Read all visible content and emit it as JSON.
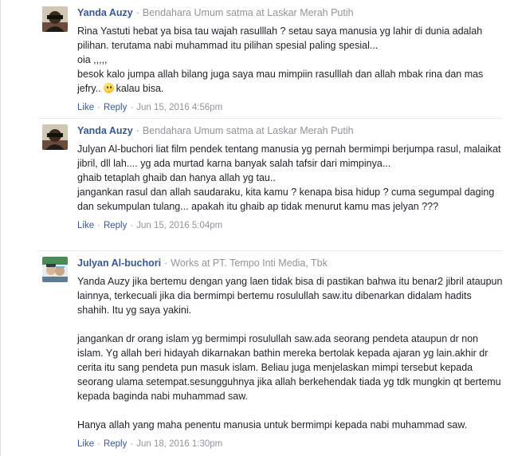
{
  "comments": [
    {
      "author": "Yanda Auzy",
      "role": "Bendahara Umum satma at Laskar Merah Putih",
      "lines": [
        "Rina Yastuti hebat ya bisa tau wajah rasulllah ? setau saya manusia yg lahir di dunia adalah pilihan. terutama nabi muhammad itu pilihan spesial paling spesial...",
        "oia ,,,,,",
        "besok kalo jumpa allah bilang juga saya mau mimpiin rasulllah dan allah mbak rina dan mas jefry..",
        "kalau bisa."
      ],
      "like": "Like",
      "reply": "Reply",
      "time": "Jun 15, 2016 4:56pm"
    },
    {
      "author": "Yanda Auzy",
      "role": "Bendahara Umum satma at Laskar Merah Putih",
      "lines": [
        "Julyan Al-buchori liat film pendek tentang manusia yg pernah bermimpi berjumpa rasul, malaikat jibril, dll lah.... yg ada murtad karna banyak salah tafsir dari mimpinya...",
        "ghaib tetaplah ghaib dan hanya allah yg tau..",
        "jangankan rasul dan allah saudaraku, kita kamu ? kenapa bisa hidup ? cuma segumpal daging dan sekumpulan tulang... apakah itu ghaib ap tidak menurut kamu mas jelyan ???"
      ],
      "like": "Like",
      "reply": "Reply",
      "time": "Jun 15, 2016 5:04pm"
    },
    {
      "author": "Julyan Al-buchori",
      "role": "Works at PT. Tempo Inti Media, Tbk",
      "lines": [
        "Yanda Auzy jika bertemu dengan yang laen tidak bisa di pastikan bahwa itu benar2 jibril ataupun lainnya, terkecuali jika dia bermimpi bertemu rosulullah saw.itu dibenarkan didalam hadits shahih. Itu yg saya yakini.",
        "jangankan dr orang islam yg bermimpi rosulullah saw.ada seorang pendeta ataupun dr non islam. Yg allah beri hidayah dikarnakan bathin mereka bertolak kepada ajaran yg lain.akhir dr cerita itu sang pendeta pun masuk islam. Beliau juga menjelaskan mimpi tersebut kepada seorang ulama setempat.sesungguhnya jika allah berkehendak tiada yg tdk mungkin qt bertemu kepada baginda nabi muhammad saw.",
        "Hanya allah yang maha penentu manusia untuk bermimpi kepada nabi muhammad saw."
      ],
      "like": "Like",
      "reply": "Reply",
      "time": "Jun 18, 2016 1:30pm"
    }
  ],
  "colors": {
    "link": "#365899",
    "meta": "#90949c",
    "text": "#1d2129",
    "divider": "#e9ebee"
  }
}
